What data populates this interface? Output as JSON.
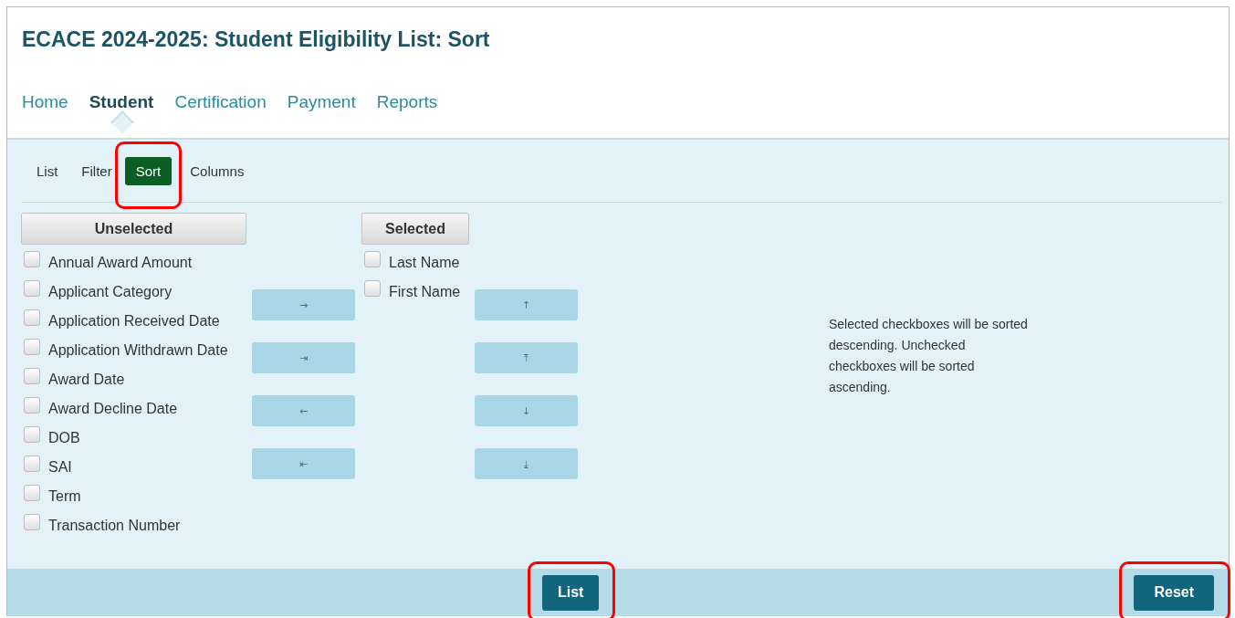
{
  "title": "ECACE 2024-2025: Student Eligibility List: Sort",
  "nav": [
    {
      "label": "Home",
      "selected": false
    },
    {
      "label": "Student",
      "selected": true
    },
    {
      "label": "Certification",
      "selected": false
    },
    {
      "label": "Payment",
      "selected": false
    },
    {
      "label": "Reports",
      "selected": false
    }
  ],
  "subnav": [
    {
      "label": "List",
      "selected": false,
      "highlighted": false
    },
    {
      "label": "Filter",
      "selected": false,
      "highlighted": false
    },
    {
      "label": "Sort",
      "selected": true,
      "highlighted": true
    },
    {
      "label": "Columns",
      "selected": false,
      "highlighted": false
    }
  ],
  "unselected": {
    "header": "Unselected",
    "items": [
      {
        "label": "Annual Award Amount",
        "checked": false
      },
      {
        "label": "Applicant Category",
        "checked": false
      },
      {
        "label": "Application Received Date",
        "checked": false
      },
      {
        "label": "Application Withdrawn Date",
        "checked": false
      },
      {
        "label": "Award Date",
        "checked": false
      },
      {
        "label": "Award Decline Date",
        "checked": false
      },
      {
        "label": "DOB",
        "checked": false
      },
      {
        "label": "SAI",
        "checked": false
      },
      {
        "label": "Term",
        "checked": false
      },
      {
        "label": "Transaction Number",
        "checked": false
      }
    ]
  },
  "move_buttons": [
    "→",
    "⇥",
    "←",
    "⇤"
  ],
  "selected": {
    "header": "Selected",
    "items": [
      {
        "label": "Last Name",
        "checked": false
      },
      {
        "label": "First Name",
        "checked": false
      }
    ]
  },
  "order_buttons": [
    "↑",
    "⤒",
    "↓",
    "⤓"
  ],
  "note": "Selected checkboxes will be sorted descending. Unchecked checkboxes will be sorted ascending.",
  "footer": [
    {
      "label": "List",
      "highlighted": true
    },
    {
      "label": "Reset",
      "highlighted": true
    }
  ]
}
